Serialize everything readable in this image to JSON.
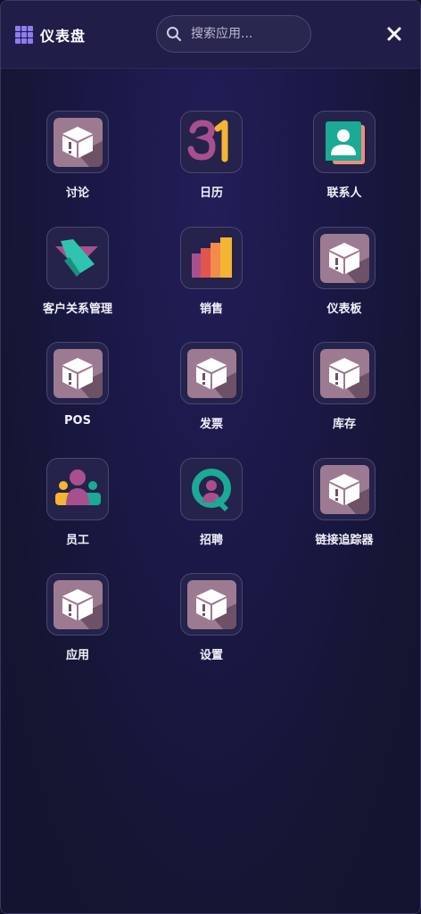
{
  "header": {
    "title": "仪表盘",
    "search_placeholder": "搜索应用..."
  },
  "apps": [
    {
      "label": "讨论",
      "icon": "generic-box-icon"
    },
    {
      "label": "日历",
      "icon": "calendar-31-icon"
    },
    {
      "label": "联系人",
      "icon": "contacts-icon"
    },
    {
      "label": "客户关系管理",
      "icon": "crm-handshake-icon"
    },
    {
      "label": "销售",
      "icon": "sales-bar-chart-icon"
    },
    {
      "label": "仪表板",
      "icon": "generic-box-icon"
    },
    {
      "label": "POS",
      "icon": "generic-box-icon"
    },
    {
      "label": "发票",
      "icon": "generic-box-icon"
    },
    {
      "label": "库存",
      "icon": "generic-box-icon"
    },
    {
      "label": "员工",
      "icon": "employees-icon"
    },
    {
      "label": "招聘",
      "icon": "recruitment-icon"
    },
    {
      "label": "链接追踪器",
      "icon": "generic-box-icon"
    },
    {
      "label": "应用",
      "icon": "generic-box-icon"
    },
    {
      "label": "设置",
      "icon": "generic-box-icon"
    }
  ],
  "colors": {
    "accent": "#8e7cf0",
    "background": "#1a1846",
    "tile_border": "#4a4770"
  }
}
